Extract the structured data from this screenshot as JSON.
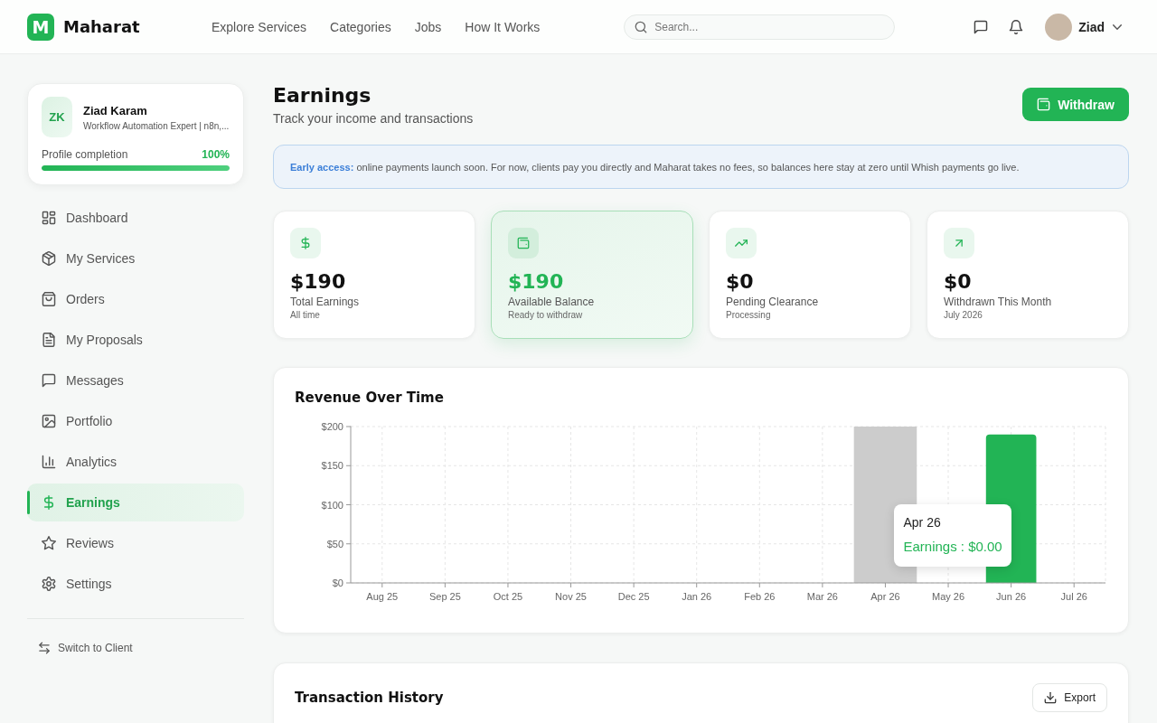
{
  "header": {
    "logo": {
      "letter": "M",
      "name": "Maharat"
    },
    "nav": [
      "Explore Services",
      "Categories",
      "Jobs",
      "How It Works"
    ],
    "search": {
      "placeholder": "Search..."
    },
    "user": {
      "name": "Ziad"
    }
  },
  "sidebar": {
    "profile": {
      "initials": "ZK",
      "name": "Ziad Karam",
      "headline": "Workflow Automation Expert | n8n,...",
      "completion_label": "Profile completion",
      "completion_value": "100%",
      "level": 1
    },
    "items": [
      {
        "label": "Dashboard",
        "selected": false
      },
      {
        "label": "My Services",
        "selected": false
      },
      {
        "label": "Orders",
        "selected": false
      },
      {
        "label": "My Proposals",
        "selected": false
      },
      {
        "label": "Messages",
        "selected": false
      },
      {
        "label": "Portfolio",
        "selected": false
      },
      {
        "label": "Analytics",
        "selected": false
      },
      {
        "label": "Earnings",
        "selected": true
      },
      {
        "label": "Reviews",
        "selected": false
      },
      {
        "label": "Settings",
        "selected": false
      }
    ],
    "switch": {
      "label": "Switch to Client"
    }
  },
  "page": {
    "title": "Earnings",
    "subtitle": "Track your income and transactions",
    "action": {
      "label": "Withdraw"
    }
  },
  "notice": {
    "text": "**Early access:** online payments launch soon. For now, clients pay you directly and Maharat takes no fees, so balances here stay at zero until Whish payments go live."
  },
  "stats": [
    {
      "value": "$190",
      "label": "Total Earnings",
      "note": "All time",
      "highlighted": false
    },
    {
      "value": "$190",
      "label": "Available Balance",
      "note": "Ready to withdraw",
      "highlighted": true
    },
    {
      "value": "$0",
      "label": "Pending Clearance",
      "note": "Processing",
      "highlighted": false
    },
    {
      "value": "$0",
      "label": "Withdrawn This Month",
      "note": "July 2026",
      "highlighted": false
    }
  ],
  "revenue_chart": {
    "chart_data": {
      "type": "bar",
      "title": "Revenue Over Time",
      "categories": [
        "Aug 25",
        "Sep 25",
        "Oct 25",
        "Nov 25",
        "Dec 25",
        "Jan 26",
        "Feb 26",
        "Mar 26",
        "Apr 26",
        "May 26",
        "Jun 26",
        "Jul 26"
      ],
      "series": [
        {
          "color": "#22b455",
          "values": [
            0,
            0,
            0,
            0,
            0,
            0,
            0,
            0,
            0,
            0,
            190,
            0
          ]
        }
      ],
      "ylim": [
        0,
        200
      ],
      "yticks": [
        {
          "value": 0,
          "label": "$0"
        },
        {
          "value": 50,
          "label": "$50"
        },
        {
          "value": 100,
          "label": "$100"
        },
        {
          "value": 150,
          "label": "$150"
        },
        {
          "value": 200,
          "label": "$200"
        }
      ],
      "grid": true,
      "bands": [
        {
          "axis": "x",
          "from": "Apr 26",
          "to": "Apr 26",
          "color": "#cccccc"
        }
      ]
    },
    "tooltip": {
      "title": "Apr 26",
      "text": "Earnings : $0.00"
    }
  },
  "transactions": {
    "title": "Transaction History",
    "action": {
      "label": "Export"
    }
  }
}
